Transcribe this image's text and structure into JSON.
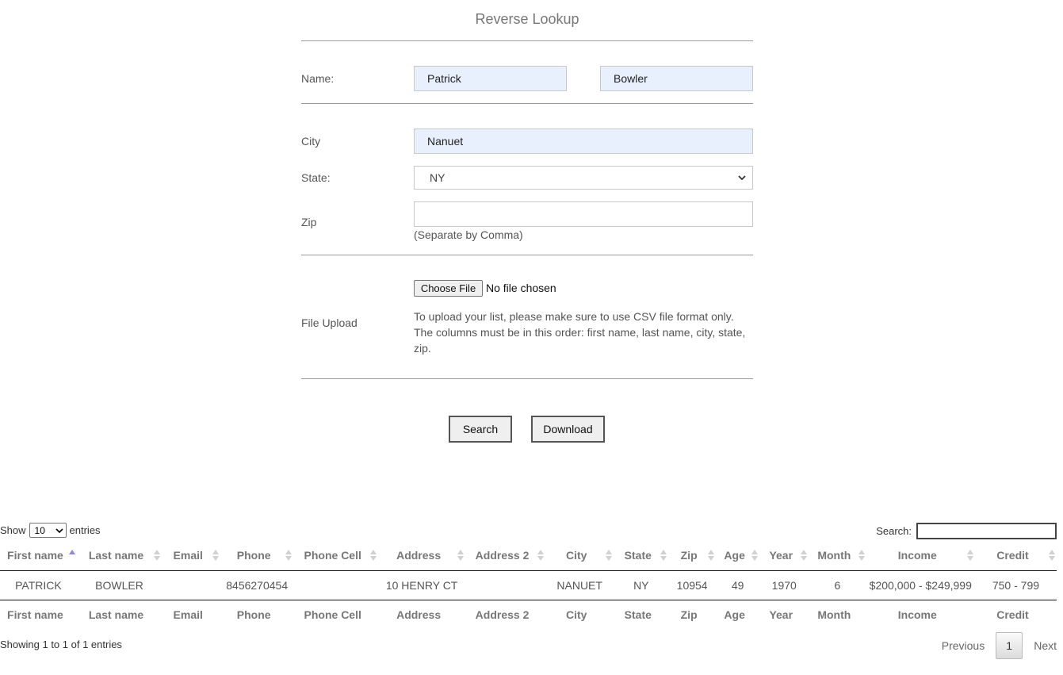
{
  "form": {
    "title": "Reverse Lookup",
    "name_label": "Name:",
    "first_name_value": "Patrick",
    "last_name_value": "Bowler",
    "city_label": "City",
    "city_value": "Nanuet",
    "state_label": "State:",
    "state_value": "NY",
    "zip_label": "Zip",
    "zip_value": "",
    "zip_hint": "(Separate by Comma)",
    "file_label": "File Upload",
    "file_button": "Choose File",
    "file_status": "No file chosen",
    "upload_note": "To upload your list, please make sure to use CSV file format only. The columns must be in this order: first name, last name, city, state, zip.",
    "search_button": "Search",
    "download_button": "Download"
  },
  "table": {
    "length_prefix": "Show",
    "length_value": "10",
    "length_suffix": "entries",
    "search_label": "Search:",
    "columns": [
      "First name",
      "Last name",
      "Email",
      "Phone",
      "Phone Cell",
      "Address",
      "Address 2",
      "City",
      "State",
      "Zip",
      "Age",
      "Year",
      "Month",
      "Income",
      "Credit"
    ],
    "rows": [
      [
        "PATRICK",
        "BOWLER",
        "",
        "8456270454",
        "",
        "10 HENRY CT",
        "",
        "NANUET",
        "NY",
        "10954",
        "49",
        "1970",
        "6",
        "$200,000 - $249,999",
        "750 - 799"
      ]
    ],
    "info": "Showing 1 to 1 of 1 entries",
    "pager": {
      "previous": "Previous",
      "current": "1",
      "next": "Next"
    }
  },
  "colors": {
    "autofill_bg": "#e8f0fe",
    "sort_active": "#8a8ad6",
    "sort_inactive": "#d0d0d0"
  }
}
